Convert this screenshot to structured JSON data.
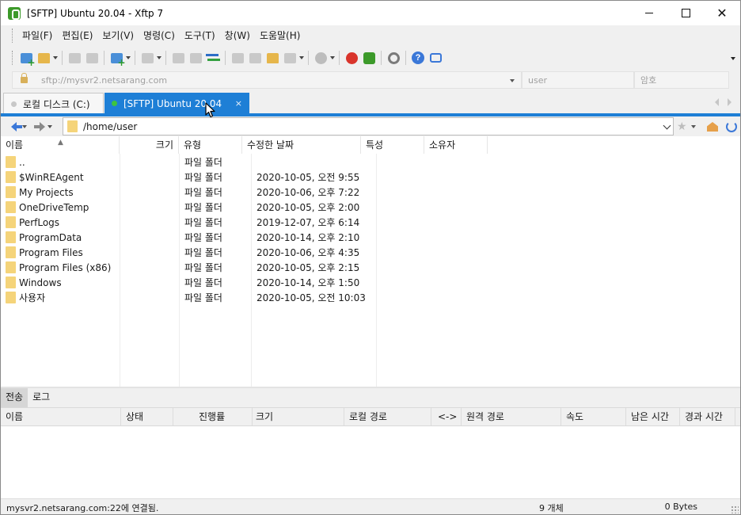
{
  "window": {
    "title": "[SFTP] Ubuntu 20.04 - Xftp 7"
  },
  "menu": [
    "파일(F)",
    "편집(E)",
    "보기(V)",
    "명령(C)",
    "도구(T)",
    "창(W)",
    "도움말(H)"
  ],
  "address": {
    "url_placeholder": "sftp://mysvr2.netsarang.com",
    "user_placeholder": "user",
    "password_placeholder": "암호"
  },
  "tabs": [
    {
      "label": "로컬 디스크 (C:)",
      "active": false,
      "status": "disconnected"
    },
    {
      "label": "[SFTP] Ubuntu 20.04",
      "active": true,
      "status": "connected",
      "close": "×"
    }
  ],
  "path": {
    "current": "/home/user"
  },
  "file_columns": [
    "이름",
    "크기",
    "유형",
    "수정한 날짜",
    "특성",
    "소유자"
  ],
  "files": [
    {
      "name": "..",
      "type": "파일 폴더",
      "modified": ""
    },
    {
      "name": "$WinREAgent",
      "type": "파일 폴더",
      "modified": "2020-10-05, 오전 9:55"
    },
    {
      "name": "My Projects",
      "type": "파일 폴더",
      "modified": "2020-10-06, 오후 7:22"
    },
    {
      "name": "OneDriveTemp",
      "type": "파일 폴더",
      "modified": "2020-10-05, 오후 2:00"
    },
    {
      "name": "PerfLogs",
      "type": "파일 폴더",
      "modified": "2019-12-07, 오후 6:14"
    },
    {
      "name": "ProgramData",
      "type": "파일 폴더",
      "modified": "2020-10-14, 오후 2:10"
    },
    {
      "name": "Program Files",
      "type": "파일 폴더",
      "modified": "2020-10-06, 오후 4:35"
    },
    {
      "name": "Program Files (x86)",
      "type": "파일 폴더",
      "modified": "2020-10-05, 오후 2:15"
    },
    {
      "name": "Windows",
      "type": "파일 폴더",
      "modified": "2020-10-14, 오후 1:50"
    },
    {
      "name": "사용자",
      "type": "파일 폴더",
      "modified": "2020-10-05, 오전 10:03"
    }
  ],
  "bottom_tabs": [
    "전송",
    "로그"
  ],
  "transfer_columns": [
    "이름",
    "상태",
    "진행률",
    "크기",
    "로컬 경로",
    "<->",
    "원격 경로",
    "속도",
    "남은 시간",
    "경과 시간"
  ],
  "status": {
    "connection": "mysvr2.netsarang.com:22에 연결됨.",
    "object_count": "9 개체",
    "bytes": "0 Bytes"
  },
  "colors": {
    "accent": "#1e7fd6",
    "folder": "#f5d47a",
    "connected": "#3ec43e"
  }
}
